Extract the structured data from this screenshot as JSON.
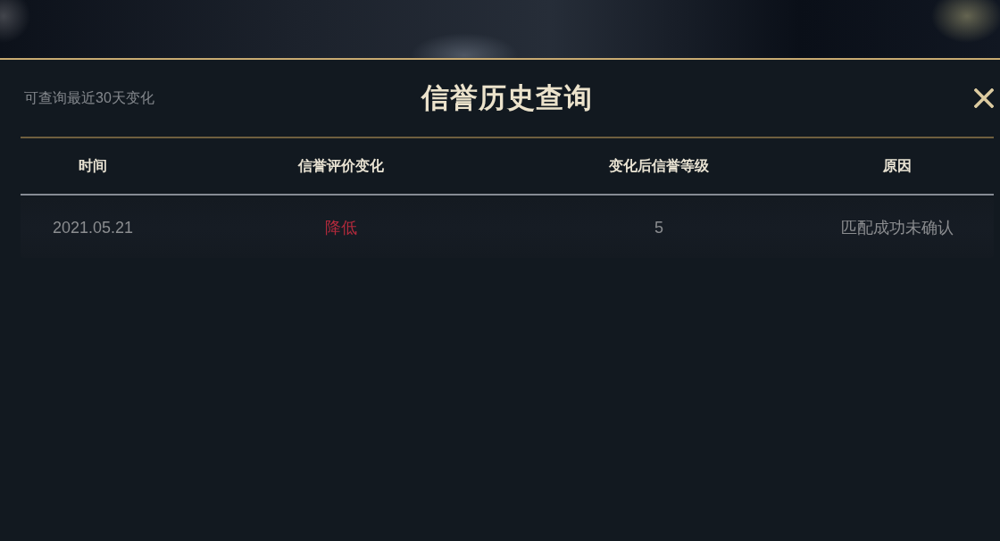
{
  "dialog": {
    "subtitle": "可查询最近30天变化",
    "title": "信誉历史查询"
  },
  "table": {
    "columns": [
      "时间",
      "信誉评价变化",
      "变化后信誉等级",
      "原因"
    ],
    "rows": [
      {
        "time": "2021.05.21",
        "change": "降低",
        "decreased": true,
        "grade": "5",
        "reason": "匹配成功未确认"
      }
    ]
  }
}
